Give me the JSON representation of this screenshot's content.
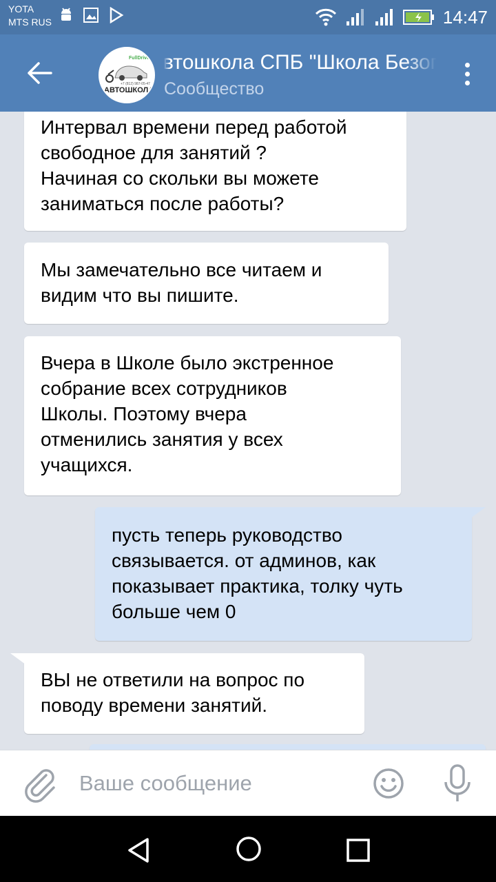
{
  "status_bar": {
    "carrier_line1": "YOTA",
    "carrier_line2": "MTS RUS",
    "time": "14:47"
  },
  "header": {
    "title": "Автошкола СПБ \"Школа Безопасности\"",
    "subtitle": "Сообщество",
    "avatar_text_top": "FullDrive",
    "avatar_text_main": "АВТОШКОЛА",
    "avatar_phone": "+7 (812) 987-05-47"
  },
  "messages": [
    {
      "direction": "in",
      "lines": [
        "Интервал времени перед работой",
        "свободное для занятий ?",
        "Начиная со скольки вы можете",
        "заниматься после работы?"
      ]
    },
    {
      "direction": "in",
      "lines": [
        "Мы замечательно все читаем и",
        "видим что вы пишите."
      ]
    },
    {
      "direction": "in",
      "lines": [
        "Вчера в Школе было экстренное",
        "собрание всех сотрудников",
        "Школы. Поэтому вчера",
        "отменились занятия у всех",
        "учащихся."
      ]
    },
    {
      "direction": "out",
      "lines": [
        "пусть теперь руководство",
        "связывается. от админов, как",
        "показывает практика, толку чуть",
        "больше чем 0"
      ]
    },
    {
      "direction": "in",
      "lines": [
        "ВЫ не ответили на вопрос по",
        "поводу времени занятий."
      ]
    }
  ],
  "input": {
    "placeholder": "Ваше сообщение"
  },
  "icons": {
    "back": "arrow-left-icon",
    "menu": "more-vertical-icon",
    "attach": "paperclip-icon",
    "emoji": "smiley-icon",
    "mic": "microphone-icon"
  },
  "colors": {
    "header": "#5181b8",
    "status_bar": "#4a76a8",
    "chat_background": "#dfe3ea",
    "incoming_bubble": "#ffffff",
    "outgoing_bubble": "#d4e3f6"
  }
}
